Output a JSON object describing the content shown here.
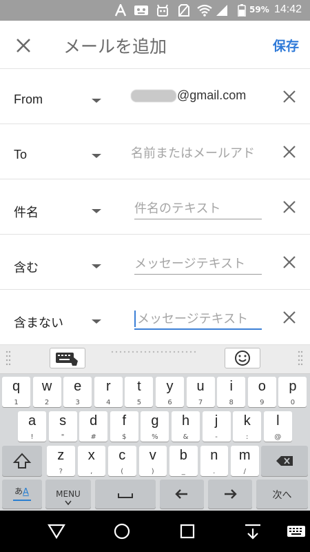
{
  "status_bar": {
    "battery_pct": "59%",
    "time": "14:42"
  },
  "app_bar": {
    "title": "メールを追加",
    "save_label": "保存"
  },
  "rows": [
    {
      "label": "From",
      "value": "@gmail.com"
    },
    {
      "label": "To",
      "placeholder": "名前またはメールアド"
    },
    {
      "label": "件名",
      "placeholder": "件名のテキスト"
    },
    {
      "label": "含む",
      "placeholder": "メッセージテキスト"
    },
    {
      "label": "含まない",
      "placeholder": "メッセージテキスト"
    }
  ],
  "keyboard": {
    "row1": [
      {
        "k": "q",
        "s": "1"
      },
      {
        "k": "w",
        "s": "2"
      },
      {
        "k": "e",
        "s": "3"
      },
      {
        "k": "r",
        "s": "4"
      },
      {
        "k": "t",
        "s": "5"
      },
      {
        "k": "y",
        "s": "6"
      },
      {
        "k": "u",
        "s": "7"
      },
      {
        "k": "i",
        "s": "8"
      },
      {
        "k": "o",
        "s": "9"
      },
      {
        "k": "p",
        "s": "0"
      }
    ],
    "row2": [
      {
        "k": "a",
        "s": "!"
      },
      {
        "k": "s",
        "s": "\""
      },
      {
        "k": "d",
        "s": "#"
      },
      {
        "k": "f",
        "s": "$"
      },
      {
        "k": "g",
        "s": "%"
      },
      {
        "k": "h",
        "s": "&"
      },
      {
        "k": "j",
        "s": "-"
      },
      {
        "k": "k",
        "s": ":"
      },
      {
        "k": "l",
        "s": "@"
      }
    ],
    "row3": [
      {
        "k": "z",
        "s": "?"
      },
      {
        "k": "x",
        "s": ","
      },
      {
        "k": "c",
        "s": "("
      },
      {
        "k": "v",
        "s": ")"
      },
      {
        "k": "b",
        "s": "_"
      },
      {
        "k": "n",
        "s": "."
      },
      {
        "k": "m",
        "s": "/"
      }
    ],
    "mode_label": "あ",
    "mode_sub": "A",
    "menu_label": "MENU",
    "next_label": "次へ"
  }
}
